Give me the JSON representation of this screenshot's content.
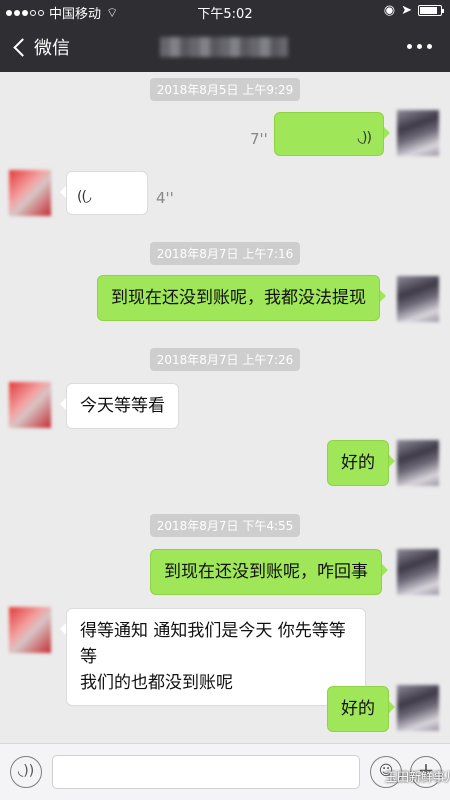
{
  "status_bar": {
    "carrier": "中国移动",
    "time": "下午5:02"
  },
  "nav": {
    "back_label": "微信"
  },
  "messages": [
    {
      "timestamp": "2018年8月5日 上午9:29"
    },
    {
      "voice_out_duration": "7''"
    },
    {
      "voice_in_duration": "4''"
    },
    {
      "timestamp": "2018年8月7日 上午7:16"
    },
    {
      "text": "到现在还没到账呢，我都没法提现"
    },
    {
      "timestamp": "2018年8月7日 上午7:26"
    },
    {
      "text": "今天等等看"
    },
    {
      "text": "好的"
    },
    {
      "timestamp": "2018年8月7日 下午4:55"
    },
    {
      "text": "到现在还没到账呢，咋回事"
    },
    {
      "text_line1": "得等通知 通知我们是今天 你先等等等",
      "text_line2": "我们的也都没到账呢"
    },
    {
      "text": "好的"
    }
  ],
  "watermark": "玉田新鲜事儿",
  "colors": {
    "bar": "#2e2e33",
    "chat_bg": "#ebebeb",
    "bubble_out": "#9fe658",
    "bubble_in": "#ffffff"
  },
  "icons": [
    "back-chevron-icon",
    "more-icon",
    "voice-wave-icon",
    "voice-button-icon",
    "emoji-icon",
    "plus-icon"
  ]
}
